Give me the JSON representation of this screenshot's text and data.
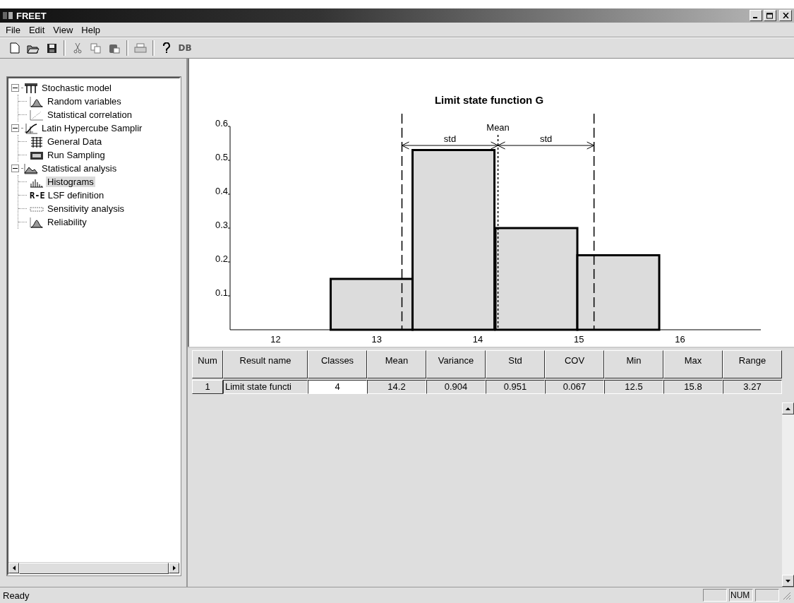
{
  "window": {
    "title": "FREET"
  },
  "menu": [
    {
      "label": "File"
    },
    {
      "label": "Edit"
    },
    {
      "label": "View"
    },
    {
      "label": "Help"
    }
  ],
  "toolbar": [
    {
      "kind": "new"
    },
    {
      "kind": "open"
    },
    {
      "kind": "save"
    },
    {
      "kind": "separator"
    },
    {
      "kind": "cut"
    },
    {
      "kind": "copy"
    },
    {
      "kind": "paste"
    },
    {
      "kind": "separator"
    },
    {
      "kind": "print"
    },
    {
      "kind": "separator"
    },
    {
      "kind": "help"
    },
    {
      "kind": "text",
      "label": "DB"
    }
  ],
  "tree": [
    {
      "label": "Stochastic model",
      "kind": "model",
      "expanded": true,
      "selected": false,
      "children": [
        {
          "label": "Random variables",
          "kind": "bell",
          "selected": false
        },
        {
          "label": "Statistical correlation",
          "kind": "scatter",
          "selected": false
        }
      ]
    },
    {
      "label": "Latin Hypercube Samplir",
      "kind": "lhs",
      "expanded": true,
      "selected": false,
      "children": [
        {
          "label": "General Data",
          "kind": "grid",
          "selected": false
        },
        {
          "label": "Run Sampling",
          "kind": "run",
          "selected": false
        }
      ]
    },
    {
      "label": "Statistical analysis",
      "kind": "analysis",
      "expanded": true,
      "selected": false,
      "children": [
        {
          "label": "Histograms",
          "kind": "histogram",
          "selected": true
        },
        {
          "label": "LSF definition",
          "kind": "text",
          "icon_text": "R-E",
          "selected": false
        },
        {
          "label": "Sensitivity analysis",
          "kind": "sensitivity",
          "selected": false
        },
        {
          "label": "Reliability",
          "kind": "bell",
          "selected": false
        }
      ]
    }
  ],
  "chart": {
    "chart_data": {
      "type": "bar",
      "title": "Limit state function G",
      "x": [
        12.95,
        13.76,
        14.58,
        15.39
      ],
      "values": [
        0.15,
        0.53,
        0.3,
        0.22
      ],
      "xlim": [
        11.55,
        16.8
      ],
      "ylim": [
        0,
        0.6
      ],
      "xticks": [
        12,
        13,
        14,
        15,
        16
      ],
      "yticks": [
        {
          "value": 0.1,
          "label": "0.1"
        },
        {
          "value": 0.2,
          "label": "0.2"
        },
        {
          "value": 0.3,
          "label": "0.3"
        },
        {
          "value": 0.4,
          "label": "0.4"
        },
        {
          "value": 0.5,
          "label": "0.5"
        },
        {
          "value": 0.6,
          "label": "0.6"
        }
      ],
      "ref_lines": [
        {
          "axis": "x",
          "value": 13.25
        },
        {
          "axis": "x",
          "value": 14.2
        },
        {
          "axis": "x",
          "value": 15.15
        }
      ],
      "annotations": [
        "Mean",
        "std",
        "std"
      ]
    }
  },
  "table": {
    "columns": [
      "Num",
      "Result name",
      "Classes",
      "Mean",
      "Variance",
      "Std",
      "COV",
      "Min",
      "Max",
      "Range"
    ],
    "rows": [
      {
        "cells": [
          "1",
          "Limit state functi",
          "4",
          "14.2",
          "0.904",
          "0.951",
          "0.067",
          "12.5",
          "15.8",
          "3.27"
        ]
      }
    ]
  },
  "status_bar": {
    "text": "Ready",
    "panels": [
      {
        "kind": "blank"
      },
      {
        "kind": "text",
        "label": "NUM"
      },
      {
        "kind": "blank"
      }
    ]
  }
}
